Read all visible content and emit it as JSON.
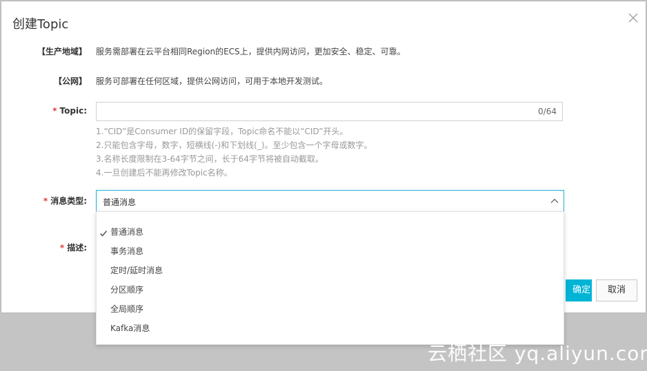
{
  "dialog": {
    "title": "创建Topic",
    "close_icon": "close-icon"
  },
  "region": {
    "label": "【生产地域】",
    "text": "服务需部署在云平台相同Region的ECS上，提供内网访问，更加安全、稳定、可靠。"
  },
  "public": {
    "label": "【公网】",
    "text": "服务可部署在任何区域，提供公网访问，可用于本地开发测试。"
  },
  "topic": {
    "required_mark": "*",
    "label": "Topic:",
    "value": "",
    "counter": "0/64",
    "hints": [
      "1.“CID”是Consumer ID的保留字段，Topic命名不能以“CID”开头。",
      "2.只能包含字母，数字，短横线(-)和下划线(_)。至少包含一个字母或数字。",
      "3.名称长度限制在3-64字节之间，长于64字节将被自动截取。",
      "4.一旦创建后不能再修改Topic名称。"
    ]
  },
  "message_type": {
    "required_mark": "*",
    "label": "消息类型:",
    "selected": "普通消息",
    "options": [
      "普通消息",
      "事务消息",
      "定时/延时消息",
      "分区顺序",
      "全局顺序",
      "Kafka消息"
    ]
  },
  "description": {
    "required_mark": "*",
    "label": "描述:"
  },
  "buttons": {
    "ok": "确定",
    "cancel": "取消"
  },
  "watermark": "云栖社区 yq.aliyun.com",
  "colors": {
    "accent": "#00b4d6",
    "required": "#e03a3a",
    "overlay": "#c4c4c4"
  }
}
